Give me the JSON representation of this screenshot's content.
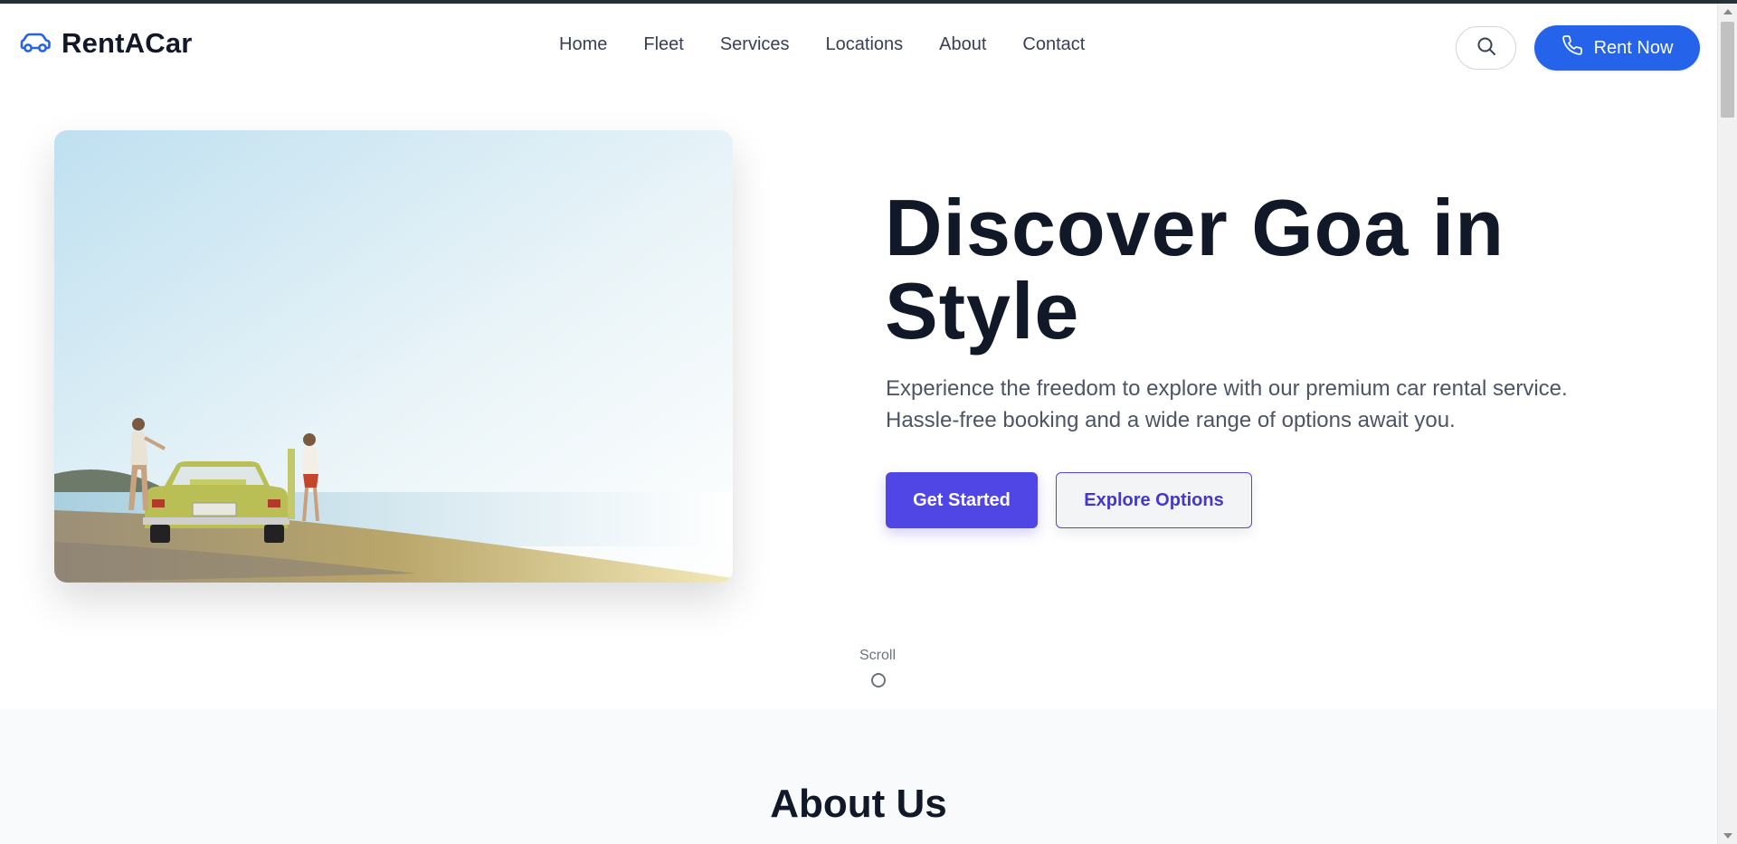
{
  "header": {
    "brand": "RentACar",
    "brand_icon": "car-icon",
    "nav": [
      "Home",
      "Fleet",
      "Services",
      "Locations",
      "About",
      "Contact"
    ],
    "search_icon": "search-icon",
    "cta_label": "Rent Now",
    "cta_icon": "phone-icon"
  },
  "hero": {
    "title": "Discover Goa in Style",
    "description": "Experience the freedom to explore with our premium car rental service. Hassle-free booking and a wide range of options await you.",
    "primary_button": "Get Started",
    "secondary_button": "Explore Options",
    "scroll_label": "Scroll"
  },
  "about": {
    "title": "About Us"
  },
  "colors": {
    "accent_blue": "#2563eb",
    "accent_indigo": "#4f46e5",
    "heading": "#111827",
    "body_text": "#4b5563"
  }
}
